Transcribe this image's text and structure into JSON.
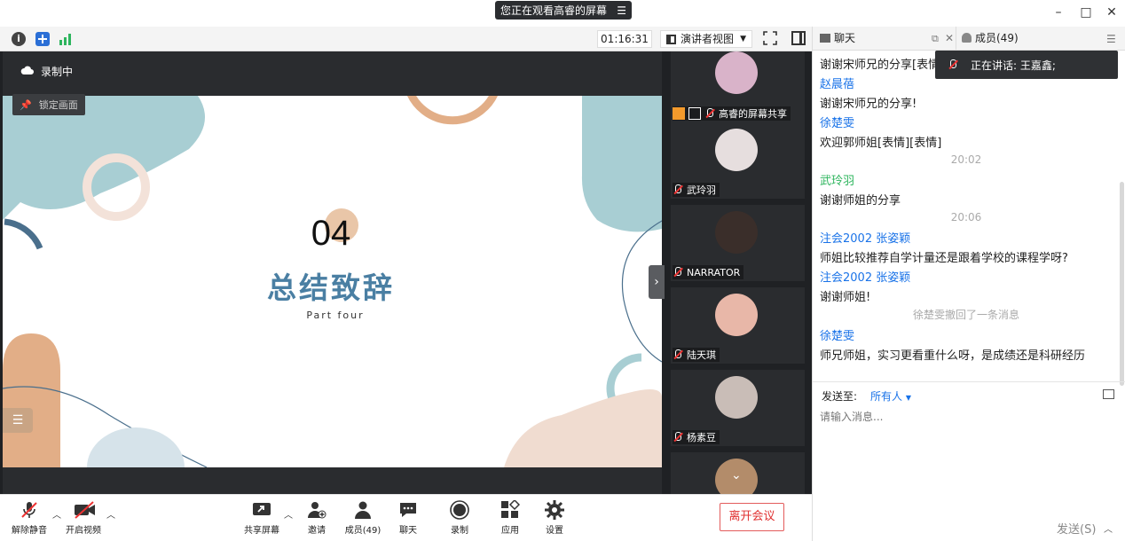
{
  "window": {
    "share_banner": "您正在观看高睿的屏幕",
    "timer": "01:16:31",
    "view_mode": "演讲者视图"
  },
  "recording": {
    "label": "录制中"
  },
  "lock": {
    "label": "锁定画面"
  },
  "slide": {
    "number": "04",
    "title": "总结致辞",
    "subtitle": "Part four"
  },
  "participants": [
    {
      "name": "高睿的屏幕共享"
    },
    {
      "name": "武玲羽"
    },
    {
      "name": "NARRATOR"
    },
    {
      "name": "陆天琪"
    },
    {
      "name": "杨素豆"
    },
    {
      "name": ""
    }
  ],
  "controls": {
    "unmute": "解除静音",
    "start_video": "开启视频",
    "share": "共享屏幕",
    "invite": "邀请",
    "members": "成员(49)",
    "chat": "聊天",
    "record": "录制",
    "apps": "应用",
    "settings": "设置",
    "leave": "离开会议"
  },
  "chat_panel": {
    "tab_chat": "聊天",
    "tab_members": "成员(49)",
    "speaking": "正在讲话: 王嘉鑫;",
    "messages": [
      {
        "text": "谢谢宋师兄的分享[表情"
      },
      {
        "sender": "赵晨蓓",
        "text": "谢谢宋师兄的分享!"
      },
      {
        "sender": "徐楚雯",
        "text": "欢迎郭师姐[表情][表情]"
      },
      {
        "time": "20:02"
      },
      {
        "sender": "武玲羽",
        "text": "谢谢师姐的分享"
      },
      {
        "time": "20:06"
      },
      {
        "sender": "注会2002 张姿颖",
        "text": "师姐比较推荐自学计量还是跟着学校的课程学呀?"
      },
      {
        "sender": "注会2002 张姿颖",
        "text": "谢谢师姐!"
      },
      {
        "notice": "徐楚雯撤回了一条消息"
      },
      {
        "sender": "徐楚雯",
        "text": "师兄师姐，实习更看重什么呀，是成绩还是科研经历"
      }
    ],
    "send_to_label": "发送至:",
    "send_to_value": "所有人",
    "input_placeholder": "请输入消息...",
    "send_button": "发送(S)"
  },
  "colors": {
    "accent": "#1a73e8",
    "leave": "#e03030",
    "slide_title": "#4a7fa3",
    "teal_shape": "#a8ced3",
    "peach_shape": "#e2ae87"
  }
}
